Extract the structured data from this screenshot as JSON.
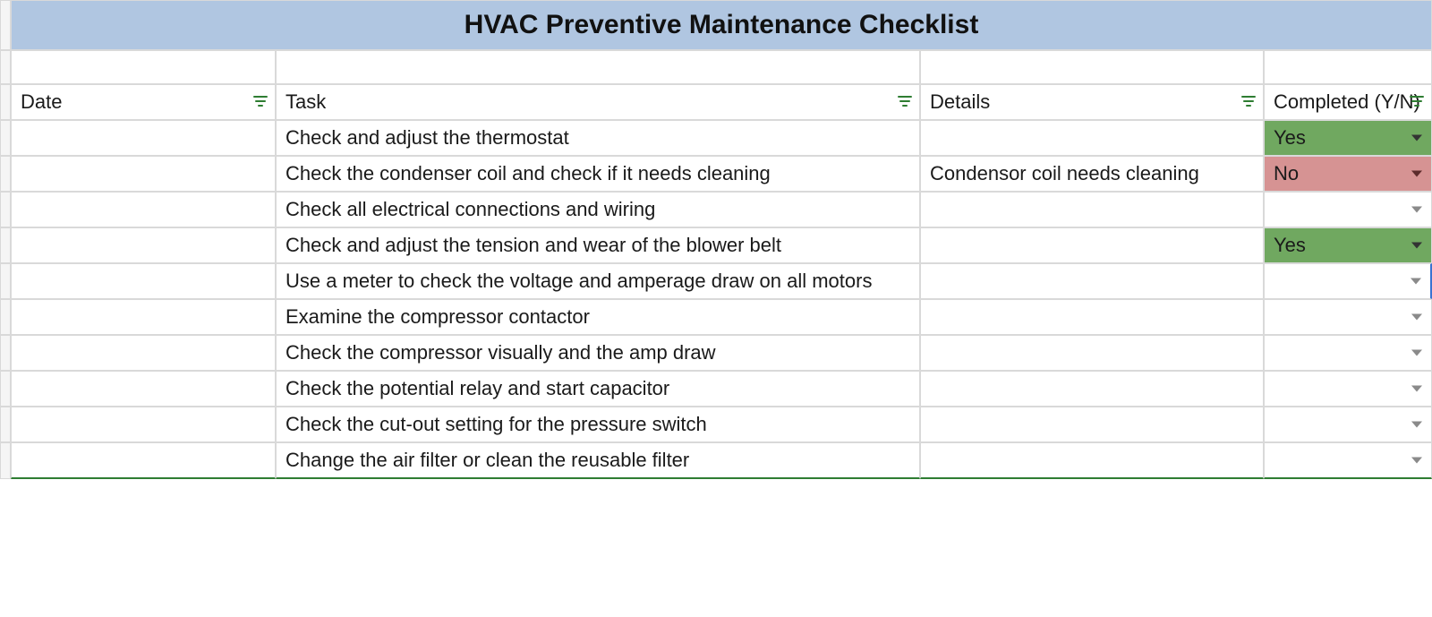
{
  "title": "HVAC Preventive Maintenance Checklist",
  "headers": {
    "date": "Date",
    "task": "Task",
    "details": "Details",
    "completed": "Completed (Y/N)"
  },
  "rows": [
    {
      "date": "",
      "task": "Check and adjust the thermostat",
      "details": "",
      "completed": "Yes",
      "status": "yes"
    },
    {
      "date": "",
      "task": "Check the condenser coil and check if it needs cleaning",
      "details": "Condensor coil needs cleaning",
      "completed": "No",
      "status": "no"
    },
    {
      "date": "",
      "task": "Check all electrical connections and wiring",
      "details": "",
      "completed": "",
      "status": ""
    },
    {
      "date": "",
      "task": "Check and adjust the tension and wear of the blower belt",
      "details": "",
      "completed": "Yes",
      "status": "yes"
    },
    {
      "date": "",
      "task": "Use a meter to check the voltage and amperage draw on all motors",
      "details": "",
      "completed": "",
      "status": ""
    },
    {
      "date": "",
      "task": "Examine the compressor contactor",
      "details": "",
      "completed": "",
      "status": ""
    },
    {
      "date": "",
      "task": "Check the compressor visually and the amp draw",
      "details": "",
      "completed": "",
      "status": ""
    },
    {
      "date": "",
      "task": "Check the potential relay and start capacitor",
      "details": "",
      "completed": "",
      "status": ""
    },
    {
      "date": "",
      "task": "Check the cut-out setting for the pressure switch",
      "details": "",
      "completed": "",
      "status": ""
    },
    {
      "date": "",
      "task": "Change the air filter or clean the reusable filter",
      "details": "",
      "completed": "",
      "status": ""
    }
  ]
}
